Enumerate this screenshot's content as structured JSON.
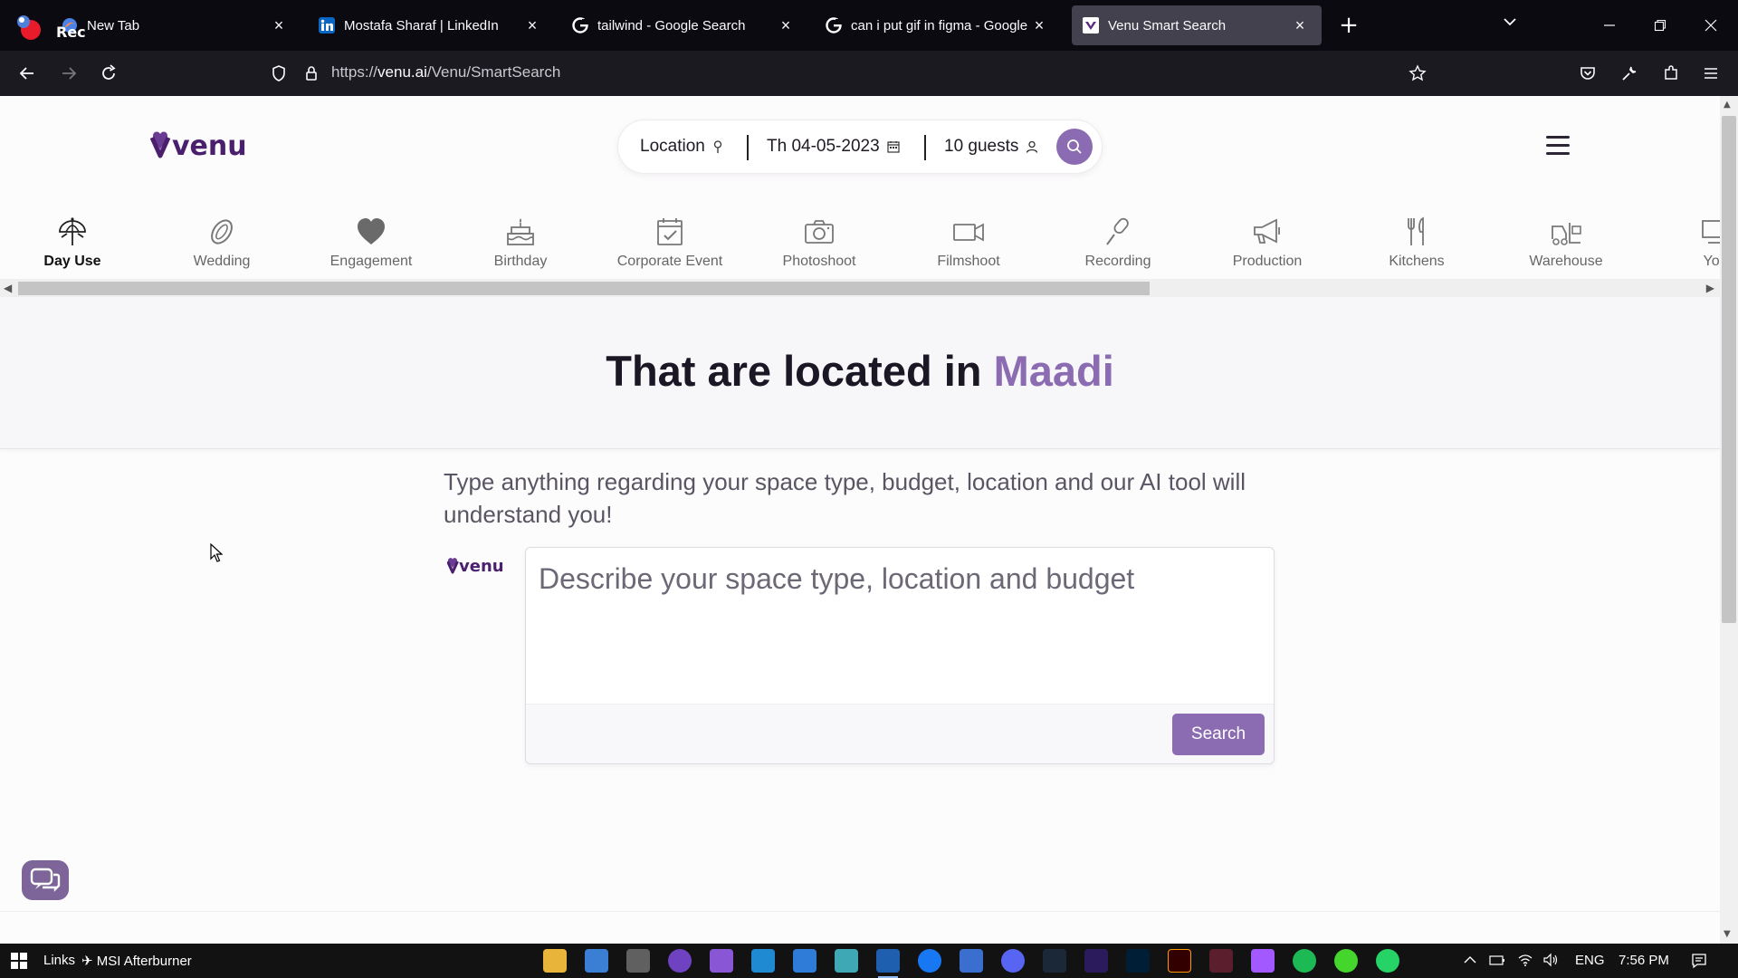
{
  "browser": {
    "rec_label": "Rec",
    "tabs": [
      {
        "title": "New Tab"
      },
      {
        "title": "Mostafa Sharaf | LinkedIn"
      },
      {
        "title": "tailwind - Google Search"
      },
      {
        "title": "can i put gif in figma - Google S"
      },
      {
        "title": "Venu Smart Search"
      }
    ],
    "close_glyph": "×",
    "newtab_glyph": "+",
    "url_prefix": "https://",
    "url_host": "venu.ai",
    "url_path": "/Venu/SmartSearch"
  },
  "header": {
    "logo_text": "venu",
    "location_label": "Location",
    "date_label": "Th 04-05-2023",
    "guests_label": "10 guests"
  },
  "categories": [
    {
      "label": "Day Use",
      "icon": "umbrella-icon",
      "active": true
    },
    {
      "label": "Wedding",
      "icon": "rings-icon"
    },
    {
      "label": "Engagement",
      "icon": "heart-icon"
    },
    {
      "label": "Birthday",
      "icon": "cake-icon"
    },
    {
      "label": "Corporate Event",
      "icon": "calendar-check-icon"
    },
    {
      "label": "Photoshoot",
      "icon": "camera-icon"
    },
    {
      "label": "Filmshoot",
      "icon": "video-camera-icon"
    },
    {
      "label": "Recording",
      "icon": "microphone-icon"
    },
    {
      "label": "Production",
      "icon": "megaphone-icon"
    },
    {
      "label": "Kitchens",
      "icon": "utensils-icon"
    },
    {
      "label": "Warehouse",
      "icon": "forklift-icon"
    },
    {
      "label": "Yog",
      "icon": "yoga-icon"
    }
  ],
  "hero": {
    "title_prefix": "That are located in ",
    "title_highlight": "Maadi",
    "highlight_color": "#8b6bb1"
  },
  "smart_search": {
    "description": "Type anything regarding your space type, budget, location and our AI tool will understand you!",
    "placeholder": "Describe your space type, location and budget",
    "button_label": "Search",
    "mini_logo_text": "venu"
  },
  "taskbar": {
    "links_label": "Links",
    "msi_label": "MSI Afterburner",
    "language": "ENG",
    "time": "7:56 PM"
  }
}
